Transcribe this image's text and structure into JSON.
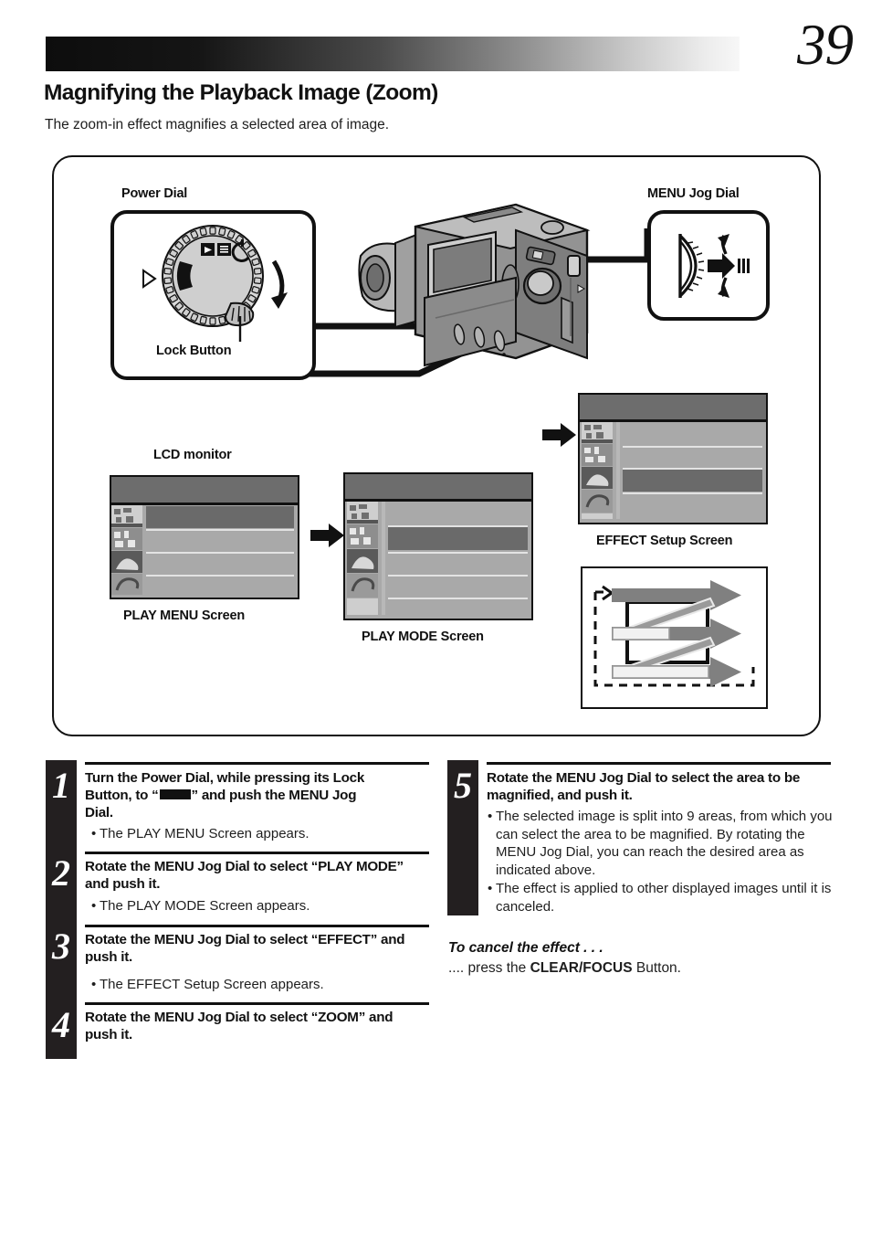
{
  "page": {
    "number": "39",
    "title": "Magnifying the Playback Image (Zoom)",
    "lede": "The zoom-in effect magnifies a selected area of image."
  },
  "diagram": {
    "power_dial_label": "Power Dial",
    "lock_button_label": "Lock Button",
    "menu_jog_dial_label": "MENU Jog Dial",
    "lcd_monitor_label": "LCD monitor",
    "play_menu_label": "PLAY MENU Screen",
    "play_mode_label": "PLAY MODE Screen",
    "effect_setup_label": "EFFECT Setup Screen"
  },
  "steps": [
    {
      "num": "1",
      "head_a": "Turn the Power Dial, while pressing its Lock",
      "head_b": "Button, to “",
      "head_c": "” and push the MENU Jog",
      "head_d": "Dial.",
      "bullets": [
        "The PLAY MENU Screen appears."
      ]
    },
    {
      "num": "2",
      "head": "Rotate the MENU Jog Dial to select “PLAY MODE” and push it.",
      "bullets": [
        "The PLAY MODE Screen appears."
      ]
    },
    {
      "num": "3",
      "head": "Rotate the MENU Jog Dial to select “EFFECT” and push it.",
      "bullets": [
        "The EFFECT Setup Screen appears."
      ]
    },
    {
      "num": "4",
      "head": "Rotate the MENU Jog Dial to select “ZOOM” and push it.",
      "bullets": []
    },
    {
      "num": "5",
      "head": "Rotate the MENU Jog Dial to select the area to be magnified, and push it.",
      "bullets": [
        "The selected image is split into 9 areas, from which you can select the area to be magnified. By rotating the MENU Jog Dial, you can reach the desired area as indicated above.",
        "The effect is applied to other displayed images until it is canceled."
      ]
    }
  ],
  "cancel": {
    "heading": "To cancel the effect . . .",
    "prefix": ".... press the ",
    "button": "CLEAR/FOCUS",
    "suffix": " Button."
  },
  "colors": {
    "ink": "#111111",
    "screen_bg": "#a9a9a9",
    "screen_title": "#6d6d6d",
    "screen_selected": "#6a6a6a",
    "step_bar": "#231f20"
  }
}
